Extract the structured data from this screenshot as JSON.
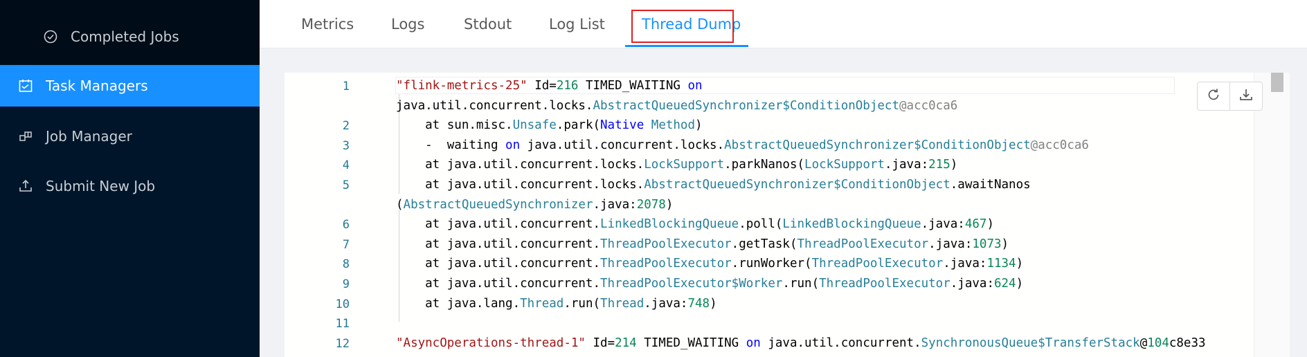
{
  "sidebar": {
    "completed_jobs": "Completed Jobs",
    "task_managers": "Task Managers",
    "job_manager": "Job Manager",
    "submit_new_job": "Submit New Job"
  },
  "tabs": [
    "Metrics",
    "Logs",
    "Stdout",
    "Log List",
    "Thread Dump"
  ],
  "active_tab": "Thread Dump",
  "editor": {
    "line_numbers": [
      "1",
      "2",
      "3",
      "4",
      "5",
      "6",
      "7",
      "8",
      "9",
      "10",
      "11",
      "12"
    ],
    "lines": [
      [
        [
          "str",
          "\"flink-metrics-25\""
        ],
        [
          "",
          " Id="
        ],
        [
          "num",
          "216"
        ],
        [
          "",
          " TIMED_WAITING "
        ],
        [
          "kw",
          "on"
        ]
      ],
      [
        [
          "",
          "java.util.concurrent.locks."
        ],
        [
          "cls",
          "AbstractQueuedSynchronizer$ConditionObject"
        ],
        [
          "gray",
          "@acc0ca6"
        ]
      ],
      [
        [
          "",
          "    at sun.misc."
        ],
        [
          "cls",
          "Unsafe"
        ],
        [
          "",
          ".park("
        ],
        [
          "kw",
          "Native"
        ],
        [
          "",
          " "
        ],
        [
          "cls",
          "Method"
        ],
        [
          "",
          ")"
        ]
      ],
      [
        [
          "",
          "    -  waiting "
        ],
        [
          "kw",
          "on"
        ],
        [
          "",
          " java.util.concurrent.locks."
        ],
        [
          "cls",
          "AbstractQueuedSynchronizer$ConditionObject"
        ],
        [
          "gray",
          "@acc0ca6"
        ]
      ],
      [
        [
          "",
          "    at java.util.concurrent.locks."
        ],
        [
          "cls",
          "LockSupport"
        ],
        [
          "",
          ".parkNanos("
        ],
        [
          "cls",
          "LockSupport"
        ],
        [
          "",
          ".java:"
        ],
        [
          "num",
          "215"
        ],
        [
          "",
          ")"
        ]
      ],
      [
        [
          "",
          "    at java.util.concurrent.locks."
        ],
        [
          "cls",
          "AbstractQueuedSynchronizer$ConditionObject"
        ],
        [
          "",
          ".awaitNanos"
        ]
      ],
      [
        [
          "",
          "("
        ],
        [
          "cls",
          "AbstractQueuedSynchronizer"
        ],
        [
          "",
          ".java:"
        ],
        [
          "num",
          "2078"
        ],
        [
          "",
          ")"
        ]
      ],
      [
        [
          "",
          "    at java.util.concurrent."
        ],
        [
          "cls",
          "LinkedBlockingQueue"
        ],
        [
          "",
          ".poll("
        ],
        [
          "cls",
          "LinkedBlockingQueue"
        ],
        [
          "",
          ".java:"
        ],
        [
          "num",
          "467"
        ],
        [
          "",
          ")"
        ]
      ],
      [
        [
          "",
          "    at java.util.concurrent."
        ],
        [
          "cls",
          "ThreadPoolExecutor"
        ],
        [
          "",
          ".getTask("
        ],
        [
          "cls",
          "ThreadPoolExecutor"
        ],
        [
          "",
          ".java:"
        ],
        [
          "num",
          "1073"
        ],
        [
          "",
          ")"
        ]
      ],
      [
        [
          "",
          "    at java.util.concurrent."
        ],
        [
          "cls",
          "ThreadPoolExecutor"
        ],
        [
          "",
          ".runWorker("
        ],
        [
          "cls",
          "ThreadPoolExecutor"
        ],
        [
          "",
          ".java:"
        ],
        [
          "num",
          "1134"
        ],
        [
          "",
          ")"
        ]
      ],
      [
        [
          "",
          "    at java.util.concurrent."
        ],
        [
          "cls",
          "ThreadPoolExecutor$Worker"
        ],
        [
          "",
          ".run("
        ],
        [
          "cls",
          "ThreadPoolExecutor"
        ],
        [
          "",
          ".java:"
        ],
        [
          "num",
          "624"
        ],
        [
          "",
          ")"
        ]
      ],
      [
        [
          "",
          "    at java.lang."
        ],
        [
          "cls",
          "Thread"
        ],
        [
          "",
          ".run("
        ],
        [
          "cls",
          "Thread"
        ],
        [
          "",
          ".java:"
        ],
        [
          "num",
          "748"
        ],
        [
          "",
          ")"
        ]
      ],
      [],
      [
        [
          "str",
          "\"AsyncOperations-thread-1\""
        ],
        [
          "",
          " Id="
        ],
        [
          "num",
          "214"
        ],
        [
          "",
          " TIMED_WAITING "
        ],
        [
          "kw",
          "on"
        ],
        [
          "",
          " java.util.concurrent."
        ],
        [
          "cls",
          "SynchronousQueue$TransferStack"
        ],
        [
          "",
          "@"
        ],
        [
          "num",
          "104"
        ],
        [
          "",
          "c8e33"
        ]
      ]
    ]
  },
  "colors": {
    "sidebar_bg": "#001529",
    "active_bg": "#1890ff",
    "highlight_box": "#e02020"
  },
  "icons": {
    "completed_jobs": "check-circle-icon",
    "task_managers": "schedule-icon",
    "job_manager": "build-icon",
    "submit_new_job": "upload-icon",
    "reload": "reload-icon",
    "download": "download-icon"
  }
}
